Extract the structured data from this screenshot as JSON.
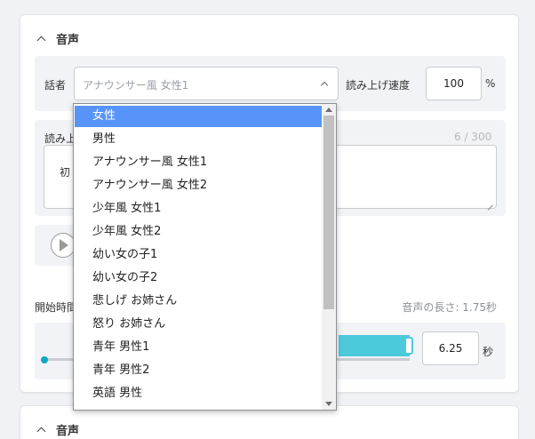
{
  "section1": {
    "title": "音声"
  },
  "section2": {
    "title": "音声"
  },
  "speaker": {
    "label": "話者",
    "selected": "アナウンサー風 女性1",
    "options": [
      "女性",
      "男性",
      "アナウンサー風 女性1",
      "アナウンサー風 女性2",
      "少年風 女性1",
      "少年風 女性2",
      "幼い女の子1",
      "幼い女の子2",
      "悲しげ お姉さん",
      "怒り お姉さん",
      "青年 男性1",
      "青年 男性2",
      "英語 男性"
    ],
    "highlighted_index": 0
  },
  "speed": {
    "label": "読み上げ速度",
    "value": "100",
    "unit": "%"
  },
  "reading": {
    "label_visible": "読み上",
    "counter": "6 / 300",
    "text_visible": "初"
  },
  "timing": {
    "label_visible": "開始時間",
    "duration": "音声の長さ: 1.75秒",
    "value": "6.25",
    "unit": "秒"
  },
  "colors": {
    "accent": "#4dc9dc",
    "selection": "#5794f9"
  }
}
